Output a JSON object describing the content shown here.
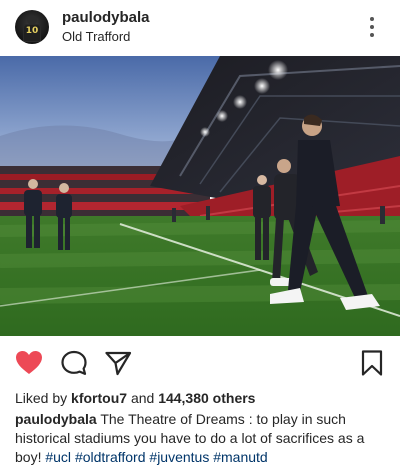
{
  "post": {
    "username": "paulodybala",
    "location": "Old Trafford",
    "avatar_text": "10"
  },
  "actions": {
    "like_icon": "heart-icon",
    "comment_icon": "comment-icon",
    "share_icon": "direct-share-icon",
    "save_icon": "bookmark-icon",
    "liked": true,
    "like_color": "#ed4956"
  },
  "likes": {
    "prefix": "Liked by",
    "user": "kfortou7",
    "joiner": "and",
    "count": "144,380 others"
  },
  "caption": {
    "username": "paulodybala",
    "text": "The Theatre of Dreams : to play in such historical stadiums you have to do a lot of sacrifices as a boy!",
    "hashtags": [
      "#ucl",
      "#oldtrafford",
      "#juventus",
      "#manutd"
    ]
  },
  "colors": {
    "hashtag": "#003569",
    "text": "#262626"
  }
}
